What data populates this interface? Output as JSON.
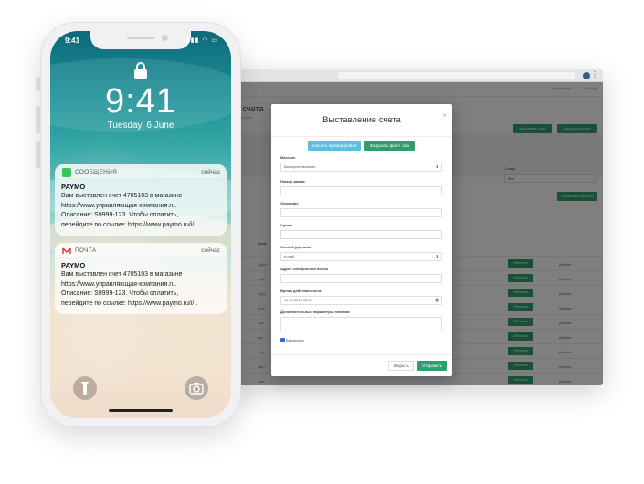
{
  "browser": {
    "page_title": "е счета",
    "page_subtitle": "ные счета",
    "topbar_user": "Александр 1",
    "topbar_exit": "Выход",
    "btn_issue": "Выставить счет",
    "btn_export": "Выгрузить отчет",
    "status_label": "Статус",
    "status_value": "Все",
    "filter_apply": "Применить фильтр",
    "table_head": "Номе",
    "rows": [
      {
        "first": "2ypm",
        "btn": "Обновить",
        "detail": "Детали"
      },
      {
        "first": "сорр",
        "btn": "Обновить",
        "detail": "Детали"
      },
      {
        "first": "2ypp",
        "btn": "Обновить",
        "detail": "Детали"
      },
      {
        "first": "tpop",
        "btn": "Обновить",
        "detail": "Детали"
      },
      {
        "first": "орп",
        "btn": "Обновить",
        "detail": "Детали"
      },
      {
        "first": "кас",
        "btn": "Обновить",
        "detail": "Детали"
      },
      {
        "first": "8ттр",
        "btn": "Обновить",
        "detail": "Детали"
      },
      {
        "first": "sam",
        "btn": "Обновить",
        "detail": "Детали"
      },
      {
        "first": "2ate",
        "btn": "Обновить",
        "detail": "Детали"
      }
    ]
  },
  "modal": {
    "title": "Выставление счета",
    "btn_download_sample": "Скачать пример файла",
    "btn_upload": "Загрузить файл .xlsx",
    "label_shop": "Магазин",
    "shop_placeholder": "Выберите магазин",
    "label_order": "Номер заказа",
    "label_description": "Описание",
    "label_amount": "Сумма",
    "label_delivery": "Способ доставки",
    "delivery_value": "e-mail",
    "label_email": "Адрес электронной почты",
    "label_expiry": "Время действия счета",
    "expiry_value": "11.12.2018 15:52",
    "label_extra": "Дополнительные параметры платежа",
    "checkbox_label": "Бессрочно",
    "btn_close": "Закрыть",
    "btn_send": "Отправить"
  },
  "phone": {
    "status_time": "9:41",
    "lock_time": "9:41",
    "lock_date": "Tuesday, 6 June",
    "notifications": [
      {
        "app": "СООБЩЕНИЯ",
        "time": "сейчас",
        "title": "PAYMO",
        "lines": [
          "Вам выставлен счет 4705103 в магазине",
          "https://www.управляющая-компания.ru.",
          "Описание: S9999-123. Чтобы оплатить,",
          "перейдите по ссылке: https://www.paymo.ru/i/.."
        ]
      },
      {
        "app": "ПОЧТА",
        "time": "сейчас",
        "title": "PAYMO",
        "lines": [
          "Вам выставлен счет 4705103 в магазине",
          "https://www.управляющая-компания.ru.",
          "Описание: S9999-123. Чтобы оплатить,",
          "перейдите по ссылке: https://www.paymo.ru/i/.."
        ]
      }
    ]
  },
  "colors": {
    "accent_green": "#2e9e6f",
    "messages_icon": "#39c45a",
    "mail_icon": "#d93025"
  },
  "icons": [
    "lock-icon",
    "messages-icon",
    "mail-icon",
    "flashlight-icon",
    "camera-icon",
    "calendar-icon",
    "close-icon"
  ]
}
